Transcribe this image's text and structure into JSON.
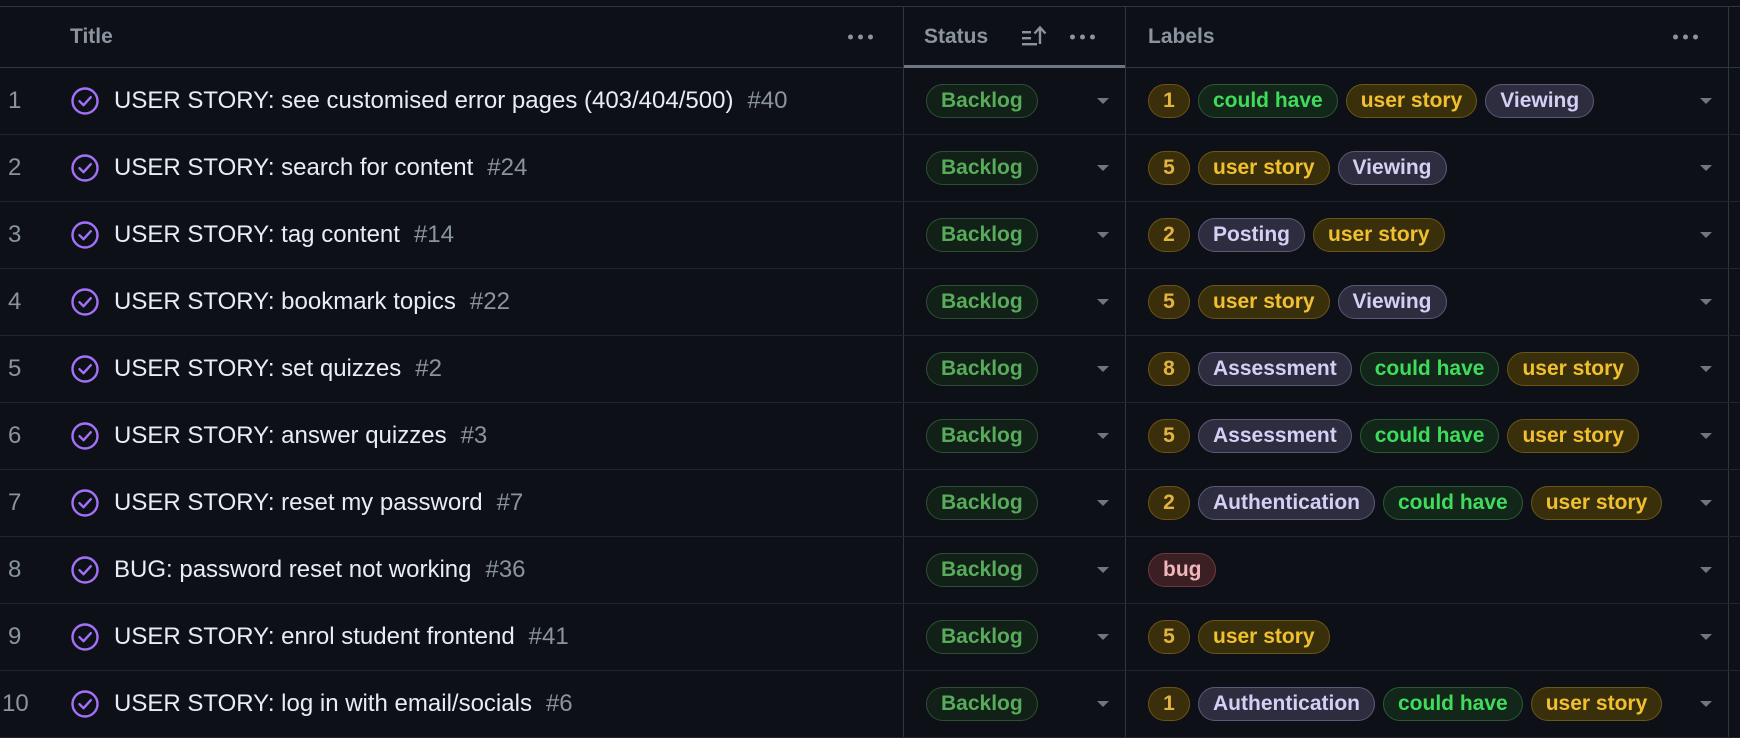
{
  "columns": {
    "title": "Title",
    "status": "Status",
    "labels": "Labels"
  },
  "rows": [
    {
      "n": "1",
      "title": "USER STORY: see customised error pages (403/404/500)",
      "issue": "#40",
      "status": "Backlog",
      "labels": [
        {
          "text": "1",
          "kind": "num"
        },
        {
          "text": "could have",
          "kind": "could"
        },
        {
          "text": "user story",
          "kind": "story"
        },
        {
          "text": "Viewing",
          "kind": "purple"
        }
      ]
    },
    {
      "n": "2",
      "title": "USER STORY: search for content",
      "issue": "#24",
      "status": "Backlog",
      "labels": [
        {
          "text": "5",
          "kind": "num"
        },
        {
          "text": "user story",
          "kind": "story"
        },
        {
          "text": "Viewing",
          "kind": "purple"
        }
      ]
    },
    {
      "n": "3",
      "title": "USER STORY: tag content",
      "issue": "#14",
      "status": "Backlog",
      "labels": [
        {
          "text": "2",
          "kind": "num"
        },
        {
          "text": "Posting",
          "kind": "purple"
        },
        {
          "text": "user story",
          "kind": "story"
        }
      ]
    },
    {
      "n": "4",
      "title": "USER STORY: bookmark topics",
      "issue": "#22",
      "status": "Backlog",
      "labels": [
        {
          "text": "5",
          "kind": "num"
        },
        {
          "text": "user story",
          "kind": "story"
        },
        {
          "text": "Viewing",
          "kind": "purple"
        }
      ]
    },
    {
      "n": "5",
      "title": "USER STORY: set quizzes",
      "issue": "#2",
      "status": "Backlog",
      "labels": [
        {
          "text": "8",
          "kind": "num"
        },
        {
          "text": "Assessment",
          "kind": "purple"
        },
        {
          "text": "could have",
          "kind": "could"
        },
        {
          "text": "user story",
          "kind": "story"
        }
      ]
    },
    {
      "n": "6",
      "title": "USER STORY: answer quizzes",
      "issue": "#3",
      "status": "Backlog",
      "labels": [
        {
          "text": "5",
          "kind": "num"
        },
        {
          "text": "Assessment",
          "kind": "purple"
        },
        {
          "text": "could have",
          "kind": "could"
        },
        {
          "text": "user story",
          "kind": "story"
        }
      ]
    },
    {
      "n": "7",
      "title": "USER STORY: reset my password",
      "issue": "#7",
      "status": "Backlog",
      "labels": [
        {
          "text": "2",
          "kind": "num"
        },
        {
          "text": "Authentication",
          "kind": "purple"
        },
        {
          "text": "could have",
          "kind": "could"
        },
        {
          "text": "user story",
          "kind": "story"
        }
      ]
    },
    {
      "n": "8",
      "title": "BUG: password reset not working",
      "issue": "#36",
      "status": "Backlog",
      "labels": [
        {
          "text": "bug",
          "kind": "bug"
        }
      ]
    },
    {
      "n": "9",
      "title": "USER STORY: enrol student frontend",
      "issue": "#41",
      "status": "Backlog",
      "labels": [
        {
          "text": "5",
          "kind": "num"
        },
        {
          "text": "user story",
          "kind": "story"
        }
      ]
    },
    {
      "n": "10",
      "title": "USER STORY: log in with email/socials",
      "issue": "#6",
      "status": "Backlog",
      "labels": [
        {
          "text": "1",
          "kind": "num"
        },
        {
          "text": "Authentication",
          "kind": "purple"
        },
        {
          "text": "could have",
          "kind": "could"
        },
        {
          "text": "user story",
          "kind": "story"
        }
      ]
    }
  ],
  "icons": {
    "issue": "issue-closed-check-icon",
    "sort": "sort-ascending-icon",
    "menu": "kebab-menu-icon",
    "dropdown": "chevron-down-icon"
  },
  "colors": {
    "background": "#0d1117",
    "issue_icon": "#a371f7",
    "status_backlog": "#57ab5a"
  }
}
